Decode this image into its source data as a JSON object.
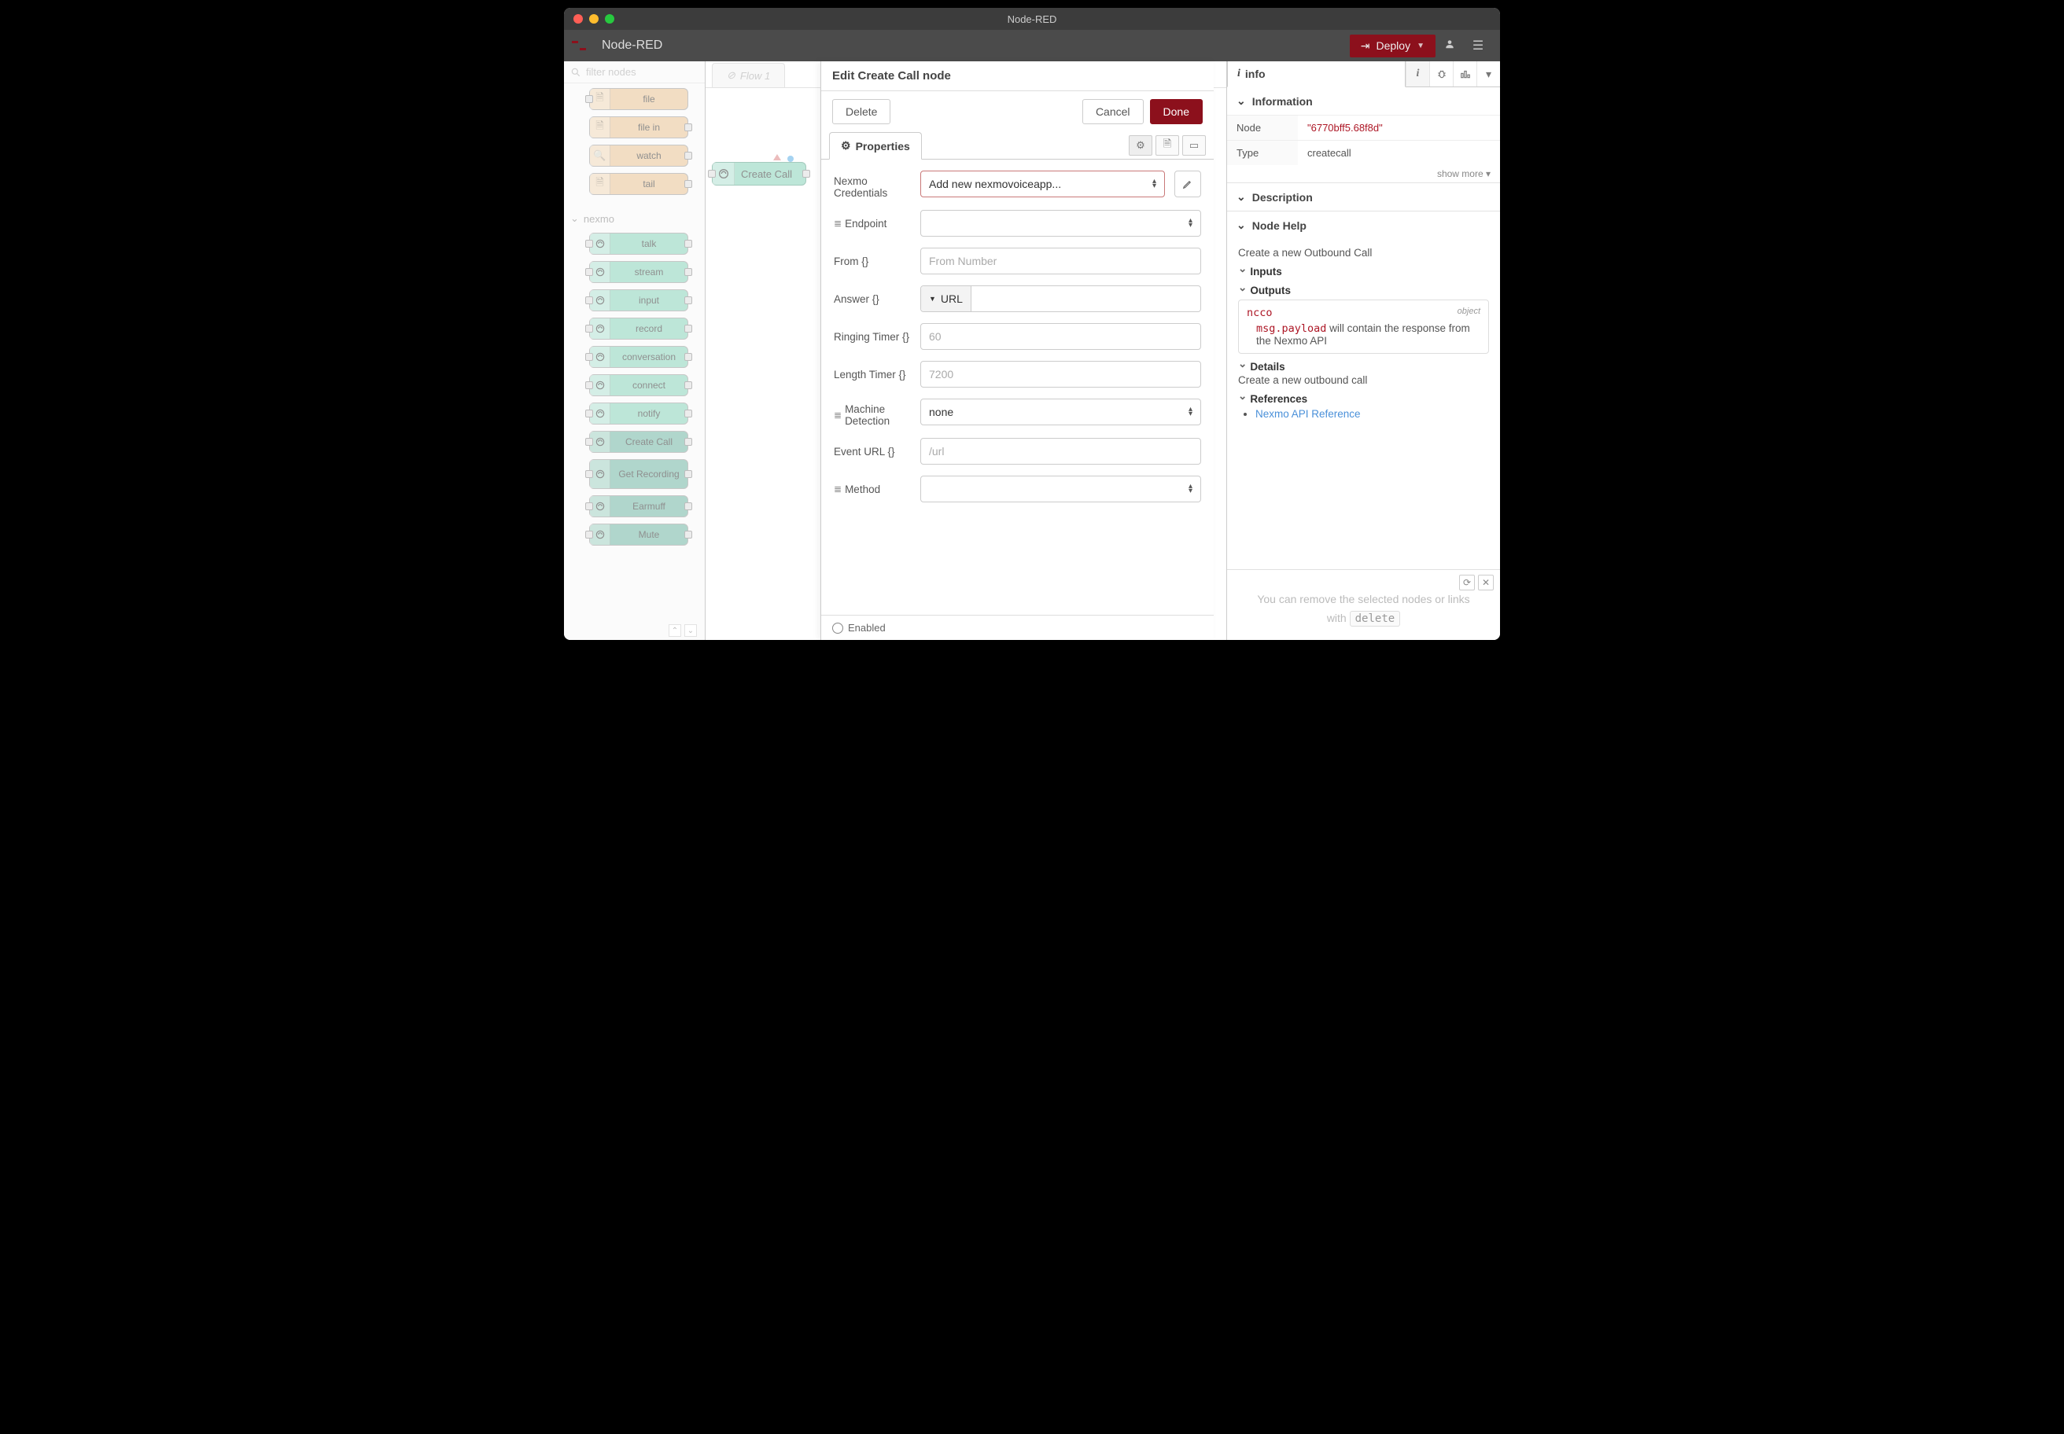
{
  "window": {
    "title": "Node-RED"
  },
  "toolbar": {
    "brand": "Node-RED",
    "deploy": "Deploy"
  },
  "palette": {
    "filter_placeholder": "filter nodes",
    "file_nodes": [
      {
        "label": "file",
        "icon": "file"
      },
      {
        "label": "file in",
        "icon": "file"
      },
      {
        "label": "watch",
        "icon": "search"
      },
      {
        "label": "tail",
        "icon": "file"
      }
    ],
    "category": "nexmo",
    "nexmo_nodes": [
      {
        "label": "talk"
      },
      {
        "label": "stream"
      },
      {
        "label": "input"
      },
      {
        "label": "record"
      },
      {
        "label": "conversation"
      },
      {
        "label": "connect"
      },
      {
        "label": "notify"
      },
      {
        "label": "Create Call"
      },
      {
        "label": "Get Recording"
      },
      {
        "label": "Earmuff"
      },
      {
        "label": "Mute"
      }
    ]
  },
  "canvas": {
    "tab": "Flow 1",
    "node": "Create Call"
  },
  "editor": {
    "title": "Edit Create Call node",
    "delete": "Delete",
    "cancel": "Cancel",
    "done": "Done",
    "properties": "Properties",
    "enabled": "Enabled",
    "fields": {
      "creds_label": "Nexmo Credentials",
      "creds_value": "Add new nexmovoiceapp...",
      "endpoint_label": "Endpoint",
      "from_label": "From {}",
      "from_placeholder": "From Number",
      "answer_label": "Answer {}",
      "answer_type": "URL",
      "ring_label": "Ringing Timer {}",
      "ring_placeholder": "60",
      "len_label": "Length Timer {}",
      "len_placeholder": "7200",
      "machine_label": "Machine Detection",
      "machine_value": "none",
      "evurl_label": "Event URL {}",
      "evurl_placeholder": "/url",
      "method_label": "Method"
    }
  },
  "sidebar": {
    "tab": "info",
    "sections": {
      "information": "Information",
      "description": "Description",
      "nodehelp": "Node Help"
    },
    "info": {
      "node_label": "Node",
      "node_id": "\"6770bff5.68f8d\"",
      "type_label": "Type",
      "type_value": "createcall",
      "show_more": "show more ▾"
    },
    "help": {
      "intro": "Create a new Outbound Call",
      "inputs": "Inputs",
      "outputs": "Outputs",
      "ncco": "ncco",
      "object": "object",
      "payload": "msg.payload",
      "payload_desc": " will contain the response from the Nexmo API",
      "details": "Details",
      "details_txt": "Create a new outbound call",
      "references": "References",
      "ref_link": "Nexmo API Reference"
    },
    "tip": {
      "line1": "You can remove the selected nodes or links",
      "line2_a": "with ",
      "line2_key": "delete"
    }
  }
}
